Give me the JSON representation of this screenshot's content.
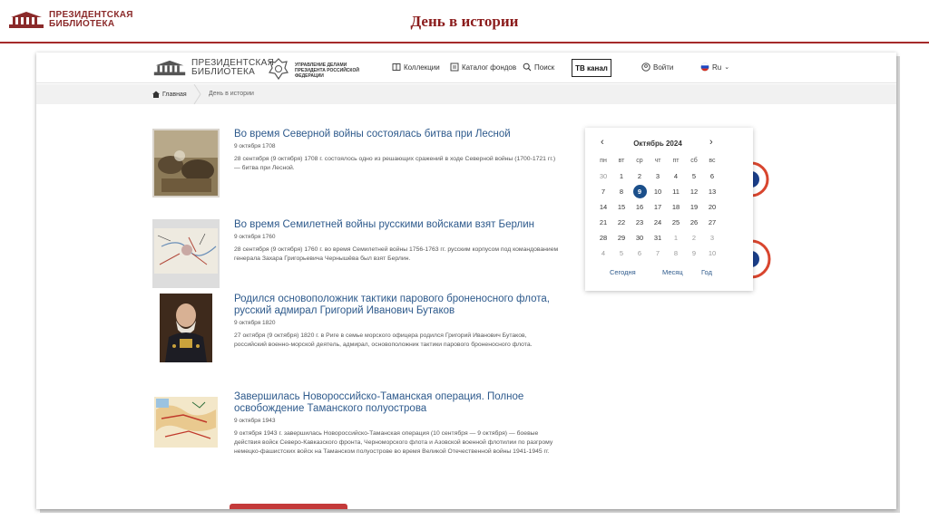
{
  "slide": {
    "logo_line1": "ПРЕЗИДЕНТСКАЯ",
    "logo_line2": "БИБЛИОТЕКА",
    "title": "День в истории"
  },
  "site": {
    "logo_line1": "ПРЕЗИДЕНТСКАЯ",
    "logo_line2": "БИБЛИОТЕКА",
    "org": "Управление делами Президента Российской Федерации",
    "nav": {
      "collections": "Коллекции",
      "catalog": "Каталог фондов",
      "search": "Поиск",
      "tv": "ТВ канал",
      "login": "Войти",
      "lang": "Ru"
    },
    "breadcrumb": {
      "home": "Главная",
      "current": "День в истории"
    }
  },
  "articles": [
    {
      "title": "Во время Северной войны состоялась битва при Лесной",
      "date": "9 октября 1708",
      "text": "28 сентября (9 октября) 1708 г. состоялось одно из решающих сражений в ходе Северной войны (1700-1721 гг.) — битва при Лесной."
    },
    {
      "title": "Во время Семилетней войны русскими войсками взят Берлин",
      "date": "9 октября 1760",
      "text": "28 сентября (9 октября) 1760 г. во время Семилетней войны 1756-1763 гг. русским корпусом под командованием генерала Захара Григорьевича Чернышёва был взят Берлин."
    },
    {
      "title": "Родился основоположник тактики парового броненосного флота, русский адмирал Григорий Иванович Бутаков",
      "date": "9 октября 1820",
      "text": "27 октября (9 октября) 1820 г. в Риге в семье морского офицера родился Григорий Иванович Бутаков, российский военно-морской деятель, адмирал, основоположник тактики парового броненосного флота."
    },
    {
      "title": "Завершилась Новороссийско-Таманская операция. Полное освобождение Таманского полуострова",
      "date": "9 октября 1943",
      "text": "9 октября 1943 г. завершилась Новороссийско-Таманская операция (10 сентября — 9 октября) — боевые действия войск Северо-Кавказского фронта, Черноморского флота и Азовской военной флотилии по разгрому немецко-фашистских войск на Таманском полуострове во время Великой Отечественной войны 1941-1945 гг."
    }
  ],
  "calendar": {
    "month": "Октябрь 2024",
    "prev": "‹",
    "next": "›",
    "weekdays": [
      "пн",
      "вт",
      "ср",
      "чт",
      "пт",
      "сб",
      "вс"
    ],
    "weeks": [
      [
        "30",
        "1",
        "2",
        "3",
        "4",
        "5",
        "6"
      ],
      [
        "7",
        "8",
        "9",
        "10",
        "11",
        "12",
        "13"
      ],
      [
        "14",
        "15",
        "16",
        "17",
        "18",
        "19",
        "20"
      ],
      [
        "21",
        "22",
        "23",
        "24",
        "25",
        "26",
        "27"
      ],
      [
        "28",
        "29",
        "30",
        "31",
        "1",
        "2",
        "3"
      ],
      [
        "4",
        "5",
        "6",
        "7",
        "8",
        "9",
        "10"
      ]
    ],
    "selected": "9",
    "today_label": "Сегодня",
    "month_label": "Месяц",
    "year_label": "Год",
    "colors": {
      "selected": "#1b4f8a",
      "accent": "#d8452e",
      "pattern_blue": "#2a6fd0"
    }
  },
  "colors": {
    "brand_red": "#8b1c1c",
    "link_blue": "#2e5a8c",
    "bulb_yellow": "#f6c222",
    "bulb_base": "#b9a7d9"
  }
}
